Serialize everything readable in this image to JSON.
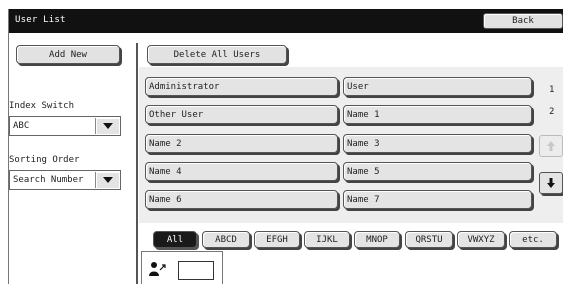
{
  "window": {
    "title": "User List",
    "back_label": "Back"
  },
  "sidebar": {
    "add_new_label": "Add New",
    "index_switch_label": "Index Switch",
    "index_switch_value": "ABC",
    "sorting_order_label": "Sorting Order",
    "sorting_order_value": "Search Number"
  },
  "main": {
    "delete_all_label": "Delete All Users",
    "users": [
      "Administrator",
      "User",
      "Other User",
      "Name 1",
      "Name 2",
      "Name 3",
      "Name 4",
      "Name 5",
      "Name 6",
      "Name 7"
    ],
    "page_current": "1",
    "page_total": "2",
    "index_tabs": [
      "All",
      "ABCD",
      "EFGH",
      "IJKL",
      "MNOP",
      "QRSTU",
      "VWXYZ",
      "etc."
    ],
    "active_tab": "All"
  },
  "colors": {
    "titlebar": "#111111",
    "list_bg": "#eeeeee",
    "button_face": "#e4e4e4",
    "active_tab": "#1a1a1a"
  },
  "icons": [
    "triangle-down-icon",
    "arrow-up-icon",
    "arrow-down-icon",
    "user-number-icon"
  ]
}
